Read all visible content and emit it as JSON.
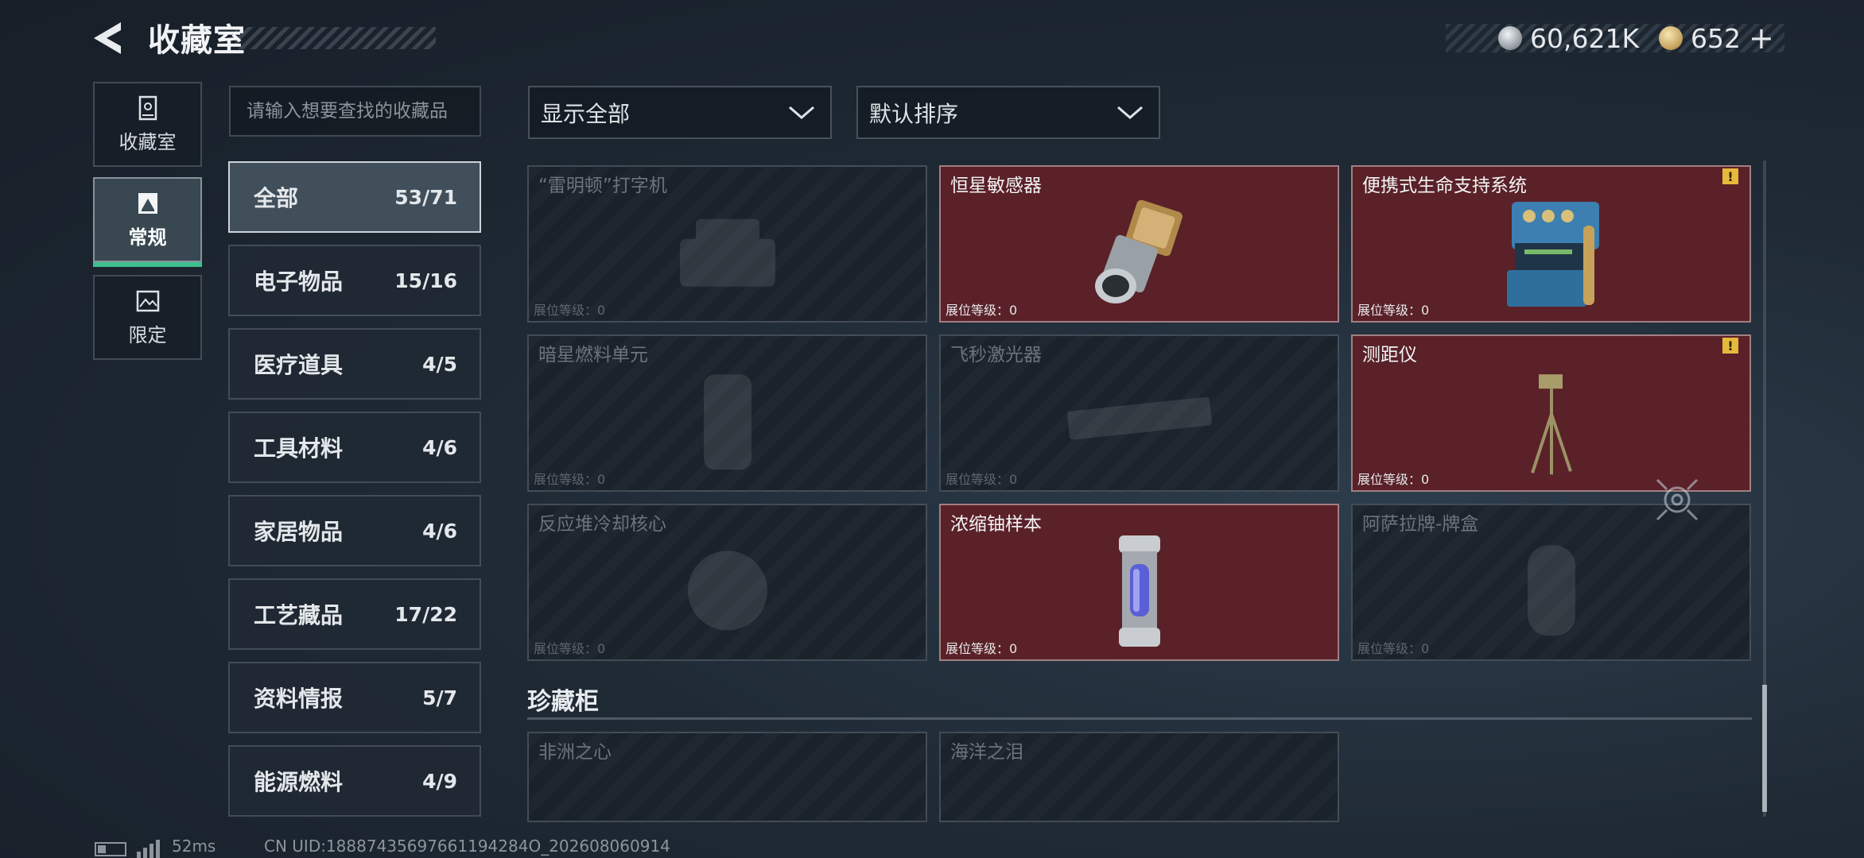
{
  "header": {
    "title": "收藏室",
    "currencies": [
      {
        "icon": "silver-coin-icon",
        "value": "60,621K"
      },
      {
        "icon": "gold-coin-icon",
        "value": "652"
      }
    ],
    "add_symbol": "+"
  },
  "side_tabs": [
    {
      "label": "收藏室",
      "icon": "cabinet-icon",
      "active": false
    },
    {
      "label": "常规",
      "icon": "photo-frame-icon",
      "active": true
    },
    {
      "label": "限定",
      "icon": "landscape-frame-icon",
      "active": false
    }
  ],
  "search": {
    "placeholder": "请输入想要查找的收藏品",
    "value": ""
  },
  "categories": [
    {
      "name": "全部",
      "count": "53/71",
      "active": true
    },
    {
      "name": "电子物品",
      "count": "15/16",
      "active": false
    },
    {
      "name": "医疗道具",
      "count": "4/5",
      "active": false
    },
    {
      "name": "工具材料",
      "count": "4/6",
      "active": false
    },
    {
      "name": "家居物品",
      "count": "4/6",
      "active": false
    },
    {
      "name": "工艺藏品",
      "count": "17/22",
      "active": false
    },
    {
      "name": "资料情报",
      "count": "5/7",
      "active": false
    },
    {
      "name": "能源燃料",
      "count": "4/9",
      "active": false
    }
  ],
  "filters": {
    "display": "显示全部",
    "sort": "默认排序"
  },
  "items": [
    {
      "title": "“雷明顿”打字机",
      "level": "展位等级：0",
      "owned": false,
      "warning": false,
      "icon": "typewriter-icon"
    },
    {
      "title": "恒星敏感器",
      "level": "展位等级：0",
      "owned": true,
      "warning": false,
      "icon": "star-sensor-icon"
    },
    {
      "title": "便携式生命支持系统",
      "level": "展位等级：0",
      "owned": true,
      "warning": true,
      "icon": "life-support-icon"
    },
    {
      "title": "暗星燃料单元",
      "level": "展位等级：0",
      "owned": false,
      "warning": false,
      "icon": "fuel-cell-icon"
    },
    {
      "title": "飞秒激光器",
      "level": "展位等级：0",
      "owned": false,
      "warning": false,
      "icon": "laser-icon"
    },
    {
      "title": "测距仪",
      "level": "展位等级：0",
      "owned": true,
      "warning": true,
      "icon": "rangefinder-icon"
    },
    {
      "title": "反应堆冷却核心",
      "level": "展位等级：0",
      "owned": false,
      "warning": false,
      "icon": "reactor-core-icon"
    },
    {
      "title": "浓缩铀样本",
      "level": "展位等级：0",
      "owned": true,
      "warning": false,
      "icon": "uranium-canister-icon"
    },
    {
      "title": "阿萨拉牌-牌盒",
      "level": "展位等级：0",
      "owned": false,
      "warning": false,
      "icon": "card-box-icon"
    }
  ],
  "treasure_section": {
    "title": "珍藏柜",
    "items": [
      {
        "title": "非洲之心",
        "owned": false
      },
      {
        "title": "海洋之泪",
        "owned": false
      }
    ]
  },
  "footer": {
    "ping": "52ms",
    "uid": "CN UID:18887435697661194284O_202608060914"
  },
  "colors": {
    "owned_card": "#5a2128",
    "accent_green": "#3fbf8f",
    "warning": "#e6b93b"
  }
}
